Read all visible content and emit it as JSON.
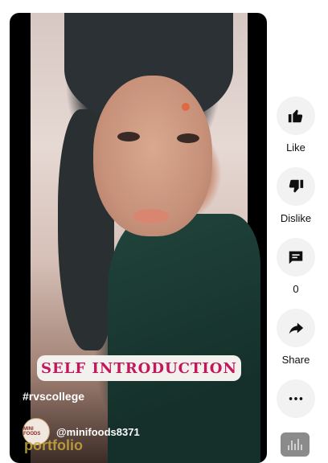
{
  "video": {
    "caption_text": "SELF INTRODUCTION",
    "hashtag": "#rvscollege",
    "channel_handle": "@minifoods8371",
    "avatar_text": "MINI FOODS",
    "overlay_partial_text": "portfolio"
  },
  "actions": {
    "like_label": "Like",
    "dislike_label": "Dislike",
    "comments_count": "0",
    "share_label": "Share"
  },
  "icons": {
    "like": "thumbs-up-icon",
    "dislike": "thumbs-down-icon",
    "comment": "comment-icon",
    "share": "share-arrow-icon",
    "more": "more-horizontal-icon",
    "sound": "audio-wave-icon"
  }
}
